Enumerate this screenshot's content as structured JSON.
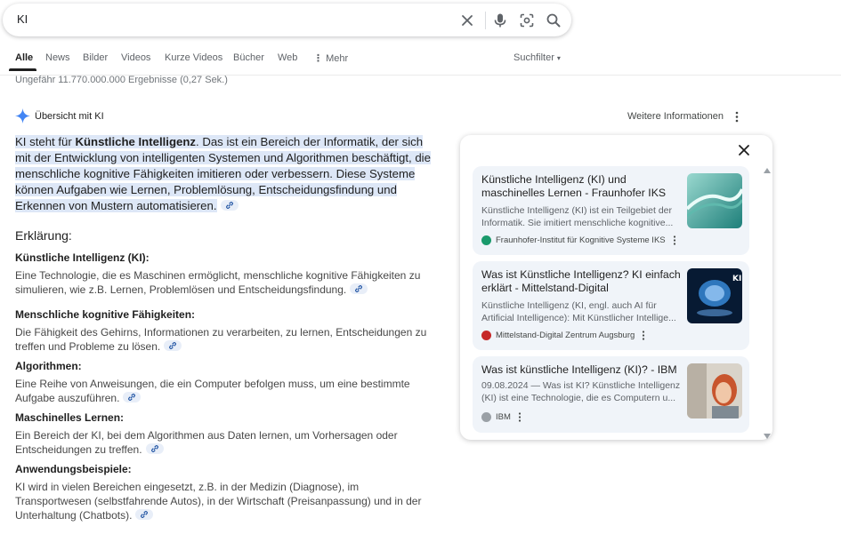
{
  "search": {
    "query": "KI"
  },
  "tabs": [
    {
      "label": "Alle",
      "active": true
    },
    {
      "label": "News"
    },
    {
      "label": "Bilder"
    },
    {
      "label": "Videos"
    },
    {
      "label": "Kurze Videos"
    },
    {
      "label": "Bücher"
    },
    {
      "label": "Web"
    },
    {
      "label": "Mehr"
    }
  ],
  "search_filter": "Suchfilter",
  "result_stats": "Ungefähr 11.770.000.000 Ergebnisse (0,27 Sek.)",
  "ai_overview": {
    "label": "Übersicht mit KI",
    "more_info": "Weitere Informationen",
    "summary_pre": "KI steht für ",
    "summary_bold": "Künstliche Intelligenz",
    "summary_post": ". Das ist ein Bereich der Informatik, der sich mit der Entwicklung von intelligenten Systemen und Algorithmen beschäftigt, die menschliche kognitive Fähigkeiten imitieren oder verbessern. Diese Systeme können Aufgaben wie Lernen, Problemlösung, Entscheidungsfindung und Erkennen von Mustern automatisieren.",
    "explanation_heading": "Erklärung:",
    "sections": [
      {
        "title": "Künstliche Intelligenz (KI):",
        "body": "Eine Technologie, die es Maschinen ermöglicht, menschliche kognitive Fähigkeiten zu simulieren, wie z.B. Lernen, Problemlösen und Entscheidungsfindung."
      },
      {
        "title": "Menschliche kognitive Fähigkeiten:",
        "body": "Die Fähigkeit des Gehirns, Informationen zu verarbeiten, zu lernen, Entscheidungen zu treffen und Probleme zu lösen."
      },
      {
        "title": "Algorithmen:",
        "body": "Eine Reihe von Anweisungen, die ein Computer befolgen muss, um eine bestimmte Aufgabe auszuführen."
      },
      {
        "title": "Maschinelles Lernen:",
        "body": "Ein Bereich der KI, bei dem Algorithmen aus Daten lernen, um Vorhersagen oder Entscheidungen zu treffen."
      },
      {
        "title": "Anwendungsbeispiele:",
        "body": "KI wird in vielen Bereichen eingesetzt, z.B. in der Medizin (Diagnose), im Transportwesen (selbstfahrende Autos), in der Wirtschaft (Preisanpassung) und in der Unterhaltung (Chatbots)."
      }
    ]
  },
  "sources": [
    {
      "title": "Künstliche Intelligenz (KI) und maschinelles Lernen - Fraunhofer IKS",
      "snippet": "Künstliche Intelligenz (KI) ist ein Teilgebiet der Informatik. Sie imitiert menschliche kognitive...",
      "source": "Fraunhofer-Institut für Kognitive Systeme IKS",
      "favicon_color": "#1a9a6c"
    },
    {
      "title": "Was ist Künstliche Intelligenz? KI einfach erklärt - Mittelstand-Digital",
      "snippet": "Künstliche Intelligenz (KI, engl. auch AI für Artificial Intelligence): Mit Künstlicher Intellige...",
      "source": "Mittelstand-Digital Zentrum Augsburg",
      "favicon_color": "#c62828"
    },
    {
      "title": "Was ist künstliche Intelligenz (KI)? - IBM",
      "snippet": "09.08.2024 — Was ist KI? Künstliche Intelligenz (KI) ist eine Technologie, die es Computern u...",
      "source": "IBM",
      "favicon_color": "#9aa0a6"
    }
  ],
  "colors": {
    "accent_blue": "#4285f4",
    "highlight": "#dde7f7",
    "card_bg": "#f0f4f9"
  }
}
